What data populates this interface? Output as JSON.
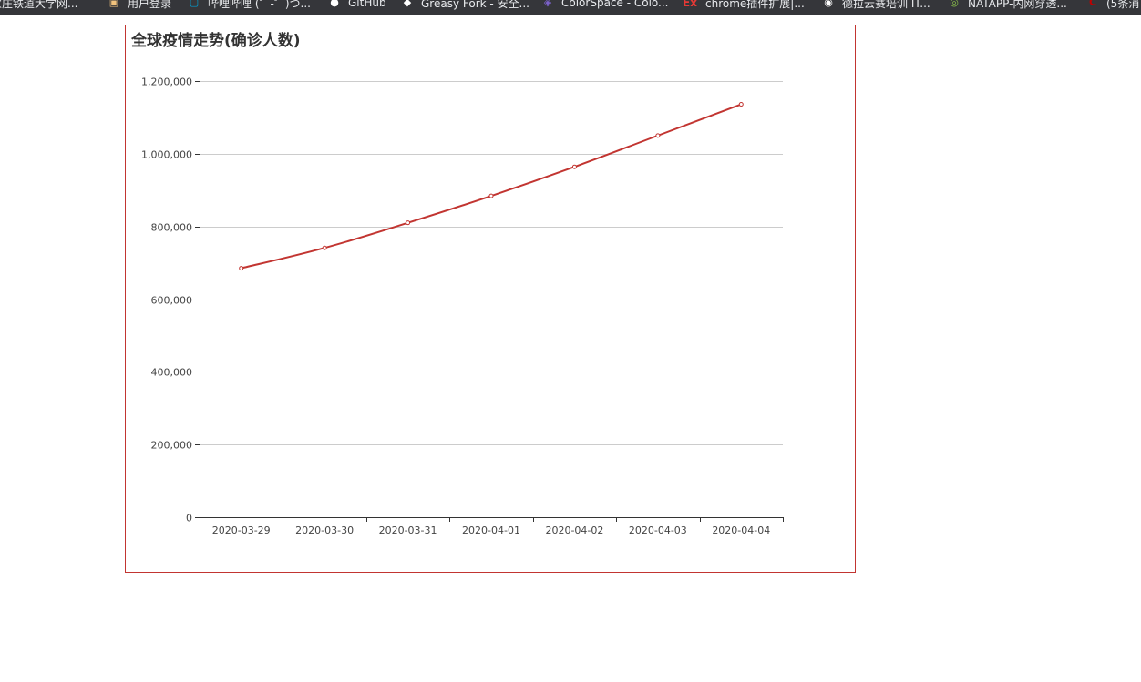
{
  "browser": {
    "bookmarks": [
      {
        "label": "家庄铁道大学网...",
        "icon": "page-icon",
        "color": "#9aa0a6"
      },
      {
        "label": "用户登录",
        "icon": "image-icon",
        "color": "#f1c27d"
      },
      {
        "label": "哔哩哔哩 (゜-゜)つ...",
        "icon": "bilibili-icon",
        "color": "#00a1d6"
      },
      {
        "label": "GitHub",
        "icon": "github-icon",
        "color": "#ffffff"
      },
      {
        "label": "Greasy Fork - 安全...",
        "icon": "greasyfork-icon",
        "color": "#ffffff"
      },
      {
        "label": "ColorSpace - Colo...",
        "icon": "colorspace-icon",
        "color": "#7b61c9"
      },
      {
        "label": "chrome插件扩展|...",
        "icon": "ex-icon",
        "color": "#e53935"
      },
      {
        "label": "德拉云赛培训 IT...",
        "icon": "globe-icon",
        "color": "#ffffff"
      },
      {
        "label": "NATAPP-内网穿透...",
        "icon": "natapp-icon",
        "color": "#8bc34a"
      },
      {
        "label": "(5条消",
        "icon": "csdn-icon",
        "color": "#c00000"
      }
    ]
  },
  "chart": {
    "title": "全球疫情走势(确诊人数)",
    "border_color": "#c23531",
    "series_color": "#c23531"
  },
  "chart_data": {
    "type": "line",
    "title": "全球疫情走势(确诊人数)",
    "xlabel": "",
    "ylabel": "",
    "categories": [
      "2020-03-29",
      "2020-03-30",
      "2020-03-31",
      "2020-04-01",
      "2020-04-02",
      "2020-04-03",
      "2020-04-04"
    ],
    "series": [
      {
        "values": [
          685000,
          741000,
          810000,
          884000,
          964000,
          1050000,
          1136000
        ]
      }
    ],
    "ylim": [
      0,
      1200000
    ],
    "yticks": [
      0,
      200000,
      400000,
      600000,
      800000,
      1000000,
      1200000
    ],
    "ytick_labels": [
      "0",
      "200,000",
      "400,000",
      "600,000",
      "800,000",
      "1,000,000",
      "1,200,000"
    ],
    "smooth": true,
    "grid": true,
    "legend": "none"
  }
}
